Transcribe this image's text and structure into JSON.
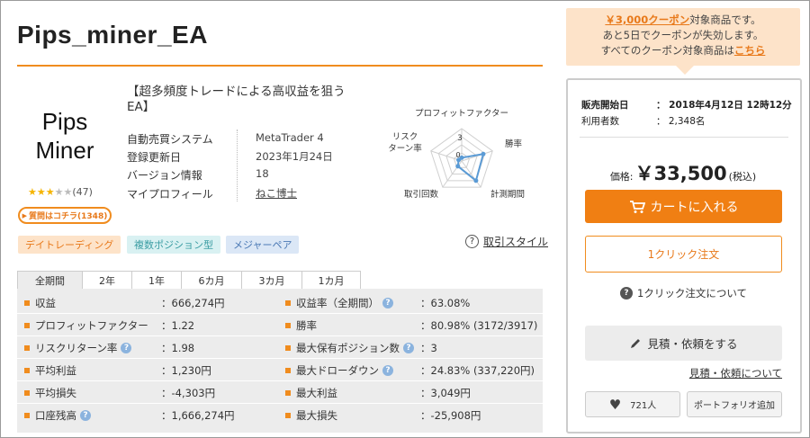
{
  "product": {
    "title": "Pips_miner_EA",
    "logo_line1": "Pips",
    "logo_line2": "Miner",
    "rating_stars": 3,
    "rating_max": 5,
    "rating_count": "(47)",
    "qa_label": "質問はコチラ(1348)",
    "description": "【超多頻度トレードによる高収益を狙うEA】"
  },
  "info": [
    {
      "label": "自動売買システム",
      "value": "MetaTrader 4"
    },
    {
      "label": "登録更新日",
      "value": "2023年1月24日"
    },
    {
      "label": "バージョン情報",
      "value": "18"
    },
    {
      "label": "マイプロフィール",
      "value": "ねこ博士"
    }
  ],
  "radar": {
    "labels": [
      "プロフィットファクター",
      "勝率",
      "計測期間",
      "取引回数",
      "リスク\nターン率"
    ],
    "scale_labels": [
      "3",
      "0"
    ],
    "values": [
      0.1,
      0.7,
      0.75,
      0.2,
      0.1
    ],
    "max": 5
  },
  "tags": [
    "デイトレーディング",
    "複数ポジション型",
    "メジャーペア"
  ],
  "trade_style": {
    "icon": "question-icon",
    "label": "取引スタイル"
  },
  "tabs": [
    "全期間",
    "2年",
    "1年",
    "6カ月",
    "3カ月",
    "1カ月"
  ],
  "stats": {
    "left": [
      {
        "label": "収益",
        "value": "：666,274円",
        "help": false
      },
      {
        "label": "プロフィットファクター",
        "value": "：1.22",
        "help": false
      },
      {
        "label": "リスクリターン率",
        "value": "：1.98",
        "help": true
      },
      {
        "label": "平均利益",
        "value": "：1,230円",
        "help": false
      },
      {
        "label": "平均損失",
        "value": "：-4,303円",
        "help": false
      },
      {
        "label": "口座残高",
        "value": "：1,666,274円",
        "help": true
      }
    ],
    "right": [
      {
        "label": "収益率（全期間）",
        "value": "：63.08%",
        "help": true
      },
      {
        "label": "勝率",
        "value": "：80.98% (3172/3917)",
        "help": false
      },
      {
        "label": "最大保有ポジション数",
        "value": "：3",
        "help": true
      },
      {
        "label": "最大ドローダウン",
        "value": "：24.83% (337,220円)",
        "help": true
      },
      {
        "label": "最大利益",
        "value": "：3,049円",
        "help": false
      },
      {
        "label": "最大損失",
        "value": "：-25,908円",
        "help": false
      }
    ]
  },
  "coupon": {
    "amount": "￥3,000クーポン",
    "line1_rest": "対象商品です。",
    "line2": "あと5日でクーポンが失効します。",
    "line3_pre": "すべてのクーポン対象商品は",
    "line3_link": "こちら"
  },
  "purchase": {
    "sale_start_label": "販売開始日",
    "sale_start_value": "：  2018年4月12日 12時12分",
    "users_label": "利用者数",
    "users_value": "：  2,348名",
    "price_label": "価格:",
    "price_value": "￥33,500",
    "price_tax": "(税込)",
    "cart_label": "カートに入れる",
    "oneclick_label": "1クリック注文",
    "oneclick_about": "1クリック注文について",
    "estimate_label": "見積・依頼をする",
    "estimate_about": "見積・依頼について",
    "favorites_count": "721人",
    "portfolio_label": "ポートフォリオ追加"
  },
  "colors": {
    "accent": "#f08c1e",
    "cart": "#f07f13",
    "radar": "#5b9bd5"
  }
}
